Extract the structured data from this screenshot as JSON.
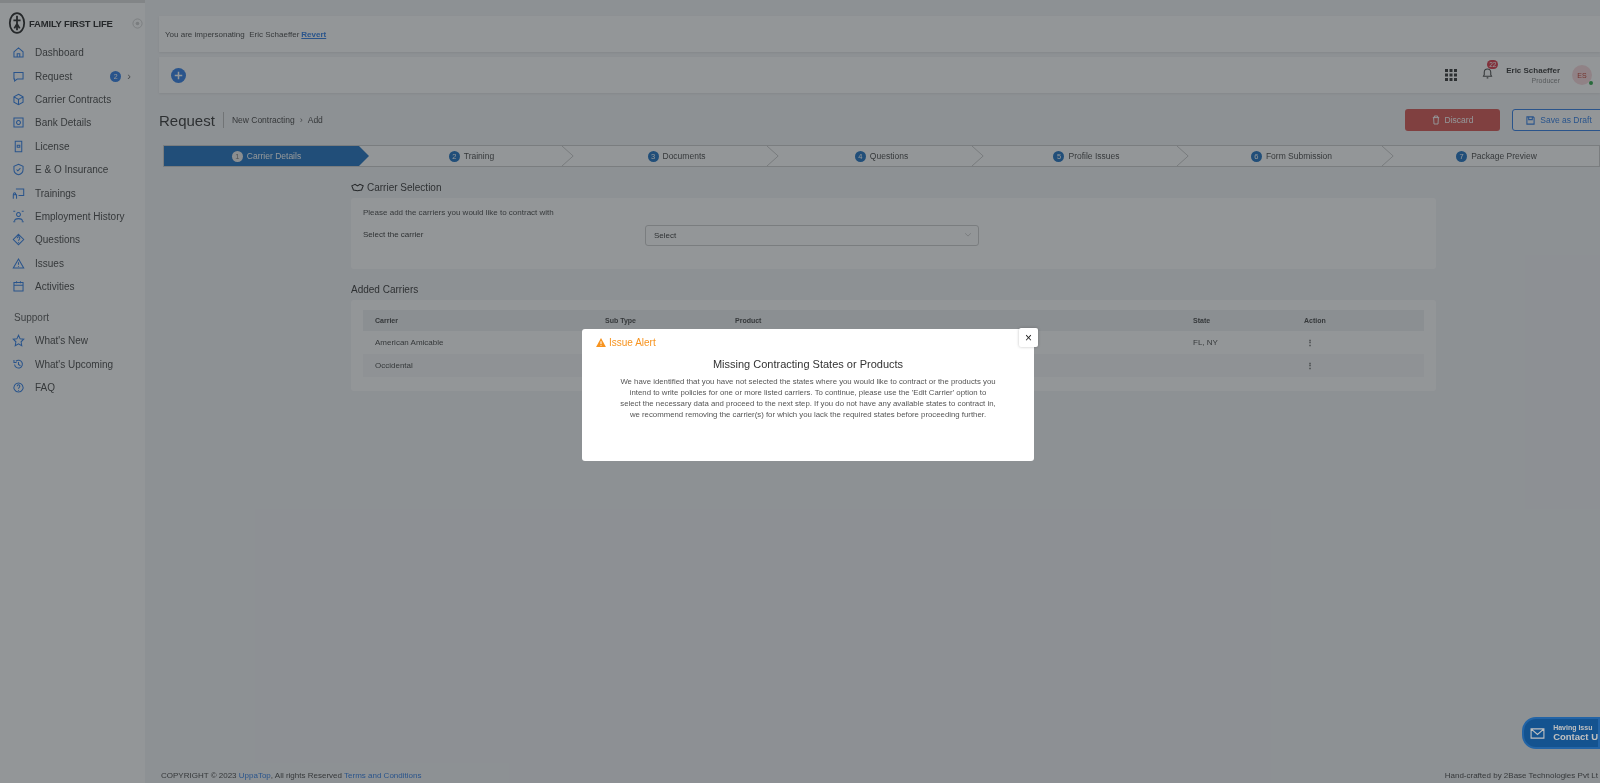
{
  "sidebar": {
    "logo": "FAMILY FIRST LIFE",
    "items": [
      {
        "label": "Dashboard"
      },
      {
        "label": "Request",
        "badge": "2",
        "chevron": "›"
      },
      {
        "label": "Carrier Contracts"
      },
      {
        "label": "Bank Details"
      },
      {
        "label": "License"
      },
      {
        "label": "E & O Insurance"
      },
      {
        "label": "Trainings"
      },
      {
        "label": "Employment History"
      },
      {
        "label": "Questions"
      },
      {
        "label": "Issues"
      },
      {
        "label": "Activities"
      }
    ],
    "support_heading": "Support",
    "support_items": [
      {
        "label": "What's New"
      },
      {
        "label": "What's Upcoming"
      },
      {
        "label": "FAQ"
      }
    ]
  },
  "impersonation": {
    "text": "You are impersonating  Eric Schaeffer",
    "link": "Revert"
  },
  "header": {
    "notifications": "22",
    "user_name": "Eric Schaeffer",
    "user_role": "Producer",
    "avatar": "ES"
  },
  "page": {
    "title": "Request",
    "breadcrumb": [
      "New Contracting",
      "Add"
    ],
    "breadcrumb_separator": "›",
    "buttons": [
      {
        "label": "Discard",
        "kind": "danger"
      },
      {
        "label": "Save as Draft",
        "kind": "outline"
      }
    ]
  },
  "steps": [
    {
      "number": "1",
      "label": "Carrier Details",
      "selected": true
    },
    {
      "number": "2",
      "label": "Training",
      "selected": false
    },
    {
      "number": "3",
      "label": "Documents",
      "selected": false
    },
    {
      "number": "4",
      "label": "Questions",
      "selected": false
    },
    {
      "number": "5",
      "label": "Profile Issues",
      "selected": false
    },
    {
      "number": "6",
      "label": "Form Submission",
      "selected": false
    },
    {
      "number": "7",
      "label": "Package Preview",
      "selected": false
    }
  ],
  "carrier_selection": {
    "title": "Carrier Selection",
    "hint": "Please add the carriers you would like to contract with",
    "field_label": "Select the carrier",
    "placeholder": "Select"
  },
  "added_carriers": {
    "title": "Added Carriers",
    "columns": [
      "Carrier",
      "Sub Type",
      "Product",
      "State",
      "Action"
    ],
    "rows": [
      {
        "carrier": "American Amicable",
        "state": "FL, NY",
        "action": "⋮"
      },
      {
        "carrier": "Occidental",
        "action": "⋮"
      }
    ]
  },
  "modal": {
    "title": "Issue Alert",
    "close": "×",
    "heading": "Missing Contracting States or Products",
    "message": "We have identified that you have not selected the states where you would like to contract or the products you intend to write policies for one or more listed carriers. To continue, please use the 'Edit Carrier' option to select the necessary data and proceed to the next step. If you do not have any available states to contract in, we recommend removing the carrier(s) for which you lack the required states before proceeding further."
  },
  "footer": {
    "copyright": "COPYRIGHT © 2023",
    "company": "UppaTop",
    "rights": ", All rights Reserved",
    "terms": "Terms and Conditions",
    "credit": "Hand-crafted by 2Base Technologies Pvt Lt"
  },
  "help_widget": {
    "line1": "Having Issu",
    "line2": "Contact U"
  }
}
